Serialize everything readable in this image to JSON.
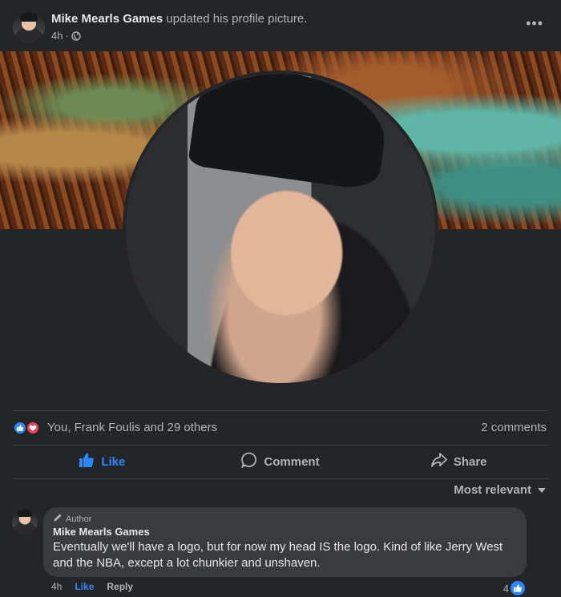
{
  "post": {
    "author_name": "Mike Mearls Games",
    "action_text": "updated his profile picture.",
    "time": "4h",
    "separator": "·",
    "audience_icon": "globe-icon",
    "more_icon": "•••"
  },
  "reactions": {
    "icons": [
      "like-icon",
      "love-icon"
    ],
    "text": "You, Frank Foulis and 29 others",
    "comments_count": "2 comments"
  },
  "actions": {
    "like": "Like",
    "comment": "Comment",
    "share": "Share"
  },
  "sort": {
    "label": "Most relevant"
  },
  "comment": {
    "badge": "Author",
    "name": "Mike Mearls Games",
    "text": "Eventually we'll have a logo, but for now my head IS the logo. Kind of like Jerry West and the NBA, except a lot chunkier and unshaven.",
    "time": "4h",
    "like": "Like",
    "reply": "Reply",
    "reaction_count": "4"
  },
  "colors": {
    "background": "#242526",
    "bubble": "#3a3b3c",
    "accent": "#2d88ff",
    "love": "#f33e58"
  }
}
